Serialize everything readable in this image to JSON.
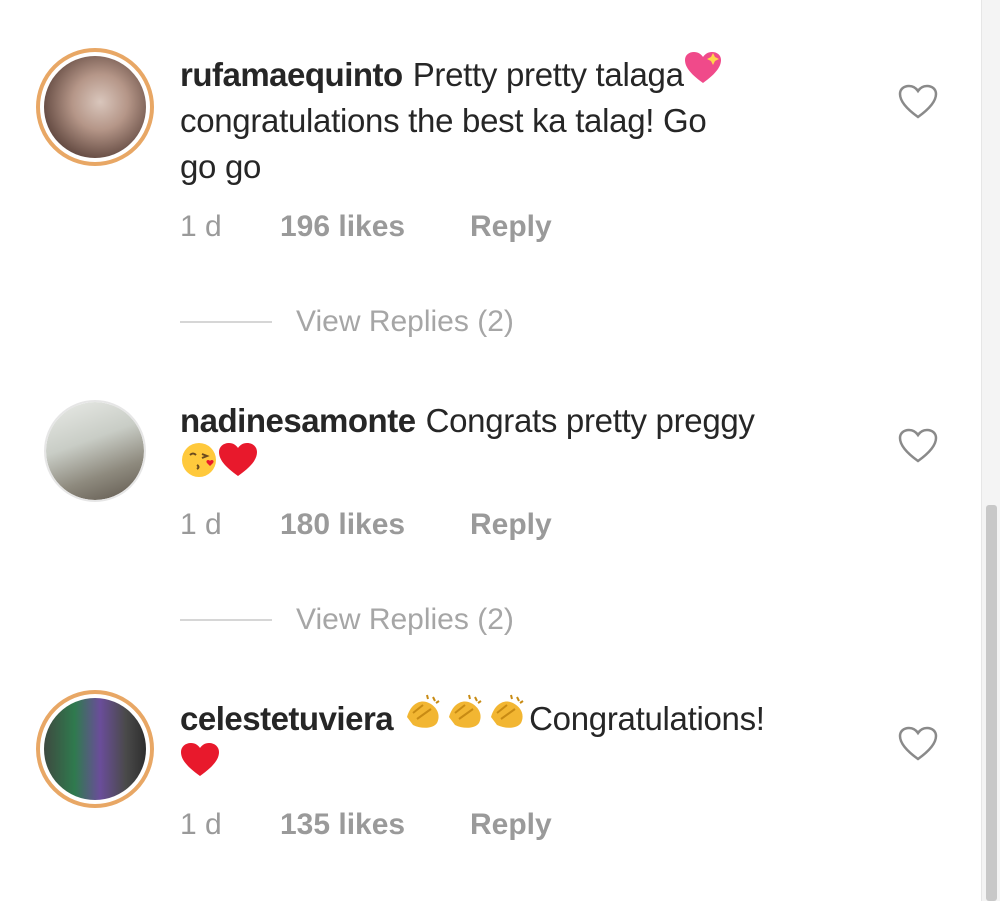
{
  "comments": [
    {
      "username": "rufamaequinto",
      "text_line1": "Pretty pretty talaga",
      "text_line2": "congratulations the best ka talag! Go",
      "text_line3": "go go",
      "time": "1 d",
      "likes": "196 likes",
      "reply_label": "Reply",
      "view_replies": "View Replies (2)",
      "emojis": [
        "sparkling-heart-emoji"
      ]
    },
    {
      "username": "nadinesamonte",
      "text_line1": "Congrats pretty preggy",
      "time": "1 d",
      "likes": "180 likes",
      "reply_label": "Reply",
      "view_replies": "View Replies (2)",
      "emojis": [
        "kissing-face-emoji",
        "red-heart-emoji"
      ]
    },
    {
      "username": "celestetuviera",
      "text_line1": "Congratulations!",
      "time": "1 d",
      "likes": "135 likes",
      "reply_label": "Reply",
      "emojis": [
        "clapping-hands-emoji",
        "clapping-hands-emoji",
        "clapping-hands-emoji",
        "red-heart-emoji"
      ]
    }
  ],
  "colors": {
    "text": "#262626",
    "meta": "#9a9a9a",
    "story_ring": "#e8a765",
    "heart_emoji": "#e8192c"
  }
}
